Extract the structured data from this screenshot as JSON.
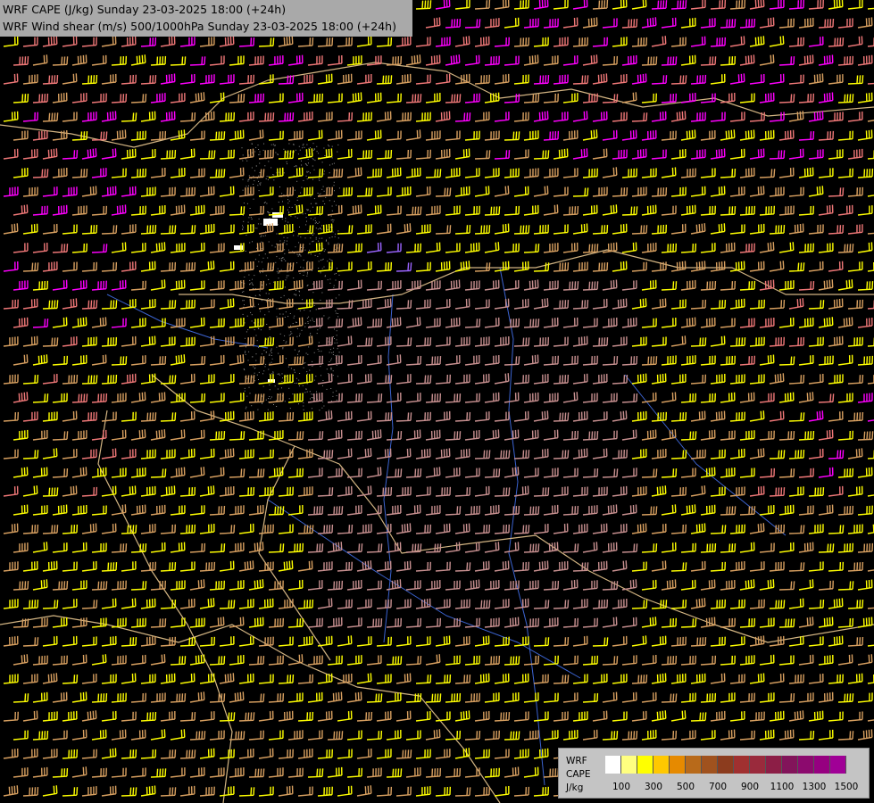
{
  "header": {
    "line1": "WRF CAPE (J/kg) Sunday 23-03-2025 18:00 (+24h)",
    "line2": "WRF Wind shear (m/s) 500/1000hPa Sunday 23-03-2025 18:00 (+24h)"
  },
  "legend": {
    "label_model": "WRF",
    "label_field": "CAPE",
    "label_unit": "J/kg",
    "tick_labels": [
      "100",
      "300",
      "500",
      "700",
      "900",
      "1100",
      "1300",
      "1500"
    ],
    "colors": [
      "#ffffff",
      "#ffff80",
      "#ffff00",
      "#ffc800",
      "#e68a00",
      "#b86a1a",
      "#a0521e",
      "#8c3c1e",
      "#a03030",
      "#9a2a3c",
      "#8c1e46",
      "#82145a",
      "#8c0a6e",
      "#960080",
      "#a00096"
    ]
  },
  "map": {
    "field_colors": {
      "barb_yellow": "#ffff00",
      "barb_tan": "#d8a060",
      "barb_pink": "#c89090",
      "barb_salmon": "#f07878",
      "barb_magenta": "#ff00ff",
      "barb_violet": "#9b64ff",
      "border": "#d2b482",
      "river": "#3c64d2",
      "background": "#000000"
    }
  }
}
